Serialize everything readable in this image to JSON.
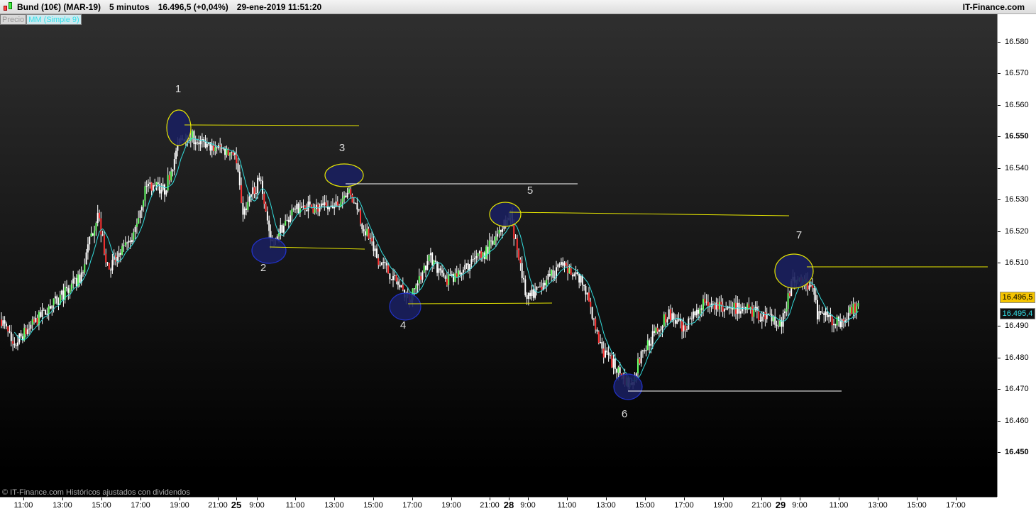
{
  "header": {
    "instrument": "Bund (10€) (MAR-19)",
    "timeframe": "5 minutos",
    "last_price": "16.496,5 (+0,04%)",
    "datetime": "29-ene-2019 11:51:20",
    "brand": "IT-Finance.com"
  },
  "legend": {
    "price": "Precio",
    "indicator": "MM (Simple 9)"
  },
  "footer": {
    "copyright": "© IT-Finance.com  Históricos ajustados con dividendos"
  },
  "colors": {
    "up": "#66ff66",
    "down": "#ff3333",
    "ma": "#33dddd",
    "annotation_fill": "#1a1f5e",
    "yellow": "#e8e800",
    "blue": "#2233cc"
  },
  "y_axis": {
    "labels": [
      "16.580",
      "16.570",
      "16.560",
      "16.550",
      "16.540",
      "16.530",
      "16.520",
      "16.510",
      "16.490",
      "16.480",
      "16.470",
      "16.460",
      "16.450"
    ],
    "bold": [
      "16.550",
      "16.450"
    ],
    "range": [
      16.44,
      16.588
    ]
  },
  "badges": {
    "price": "16.496,5",
    "ma": "16.495,4"
  },
  "x_axis": {
    "labels": [
      "11:00",
      "13:00",
      "15:00",
      "17:00",
      "19:00",
      "21:00",
      "25",
      "9:00",
      "11:00",
      "13:00",
      "15:00",
      "17:00",
      "19:00",
      "21:00",
      "28",
      "9:00",
      "11:00",
      "13:00",
      "15:00",
      "17:00",
      "19:00",
      "21:00",
      "29",
      "9:00",
      "11:00",
      "13:00",
      "15:00",
      "17:00"
    ],
    "day_markers": [
      "25",
      "28",
      "29"
    ]
  },
  "chart_data": {
    "type": "candlestick",
    "indicator": "MM (Simple 9)",
    "price_path": [
      [
        0,
        16.492
      ],
      [
        7,
        16.484
      ],
      [
        26,
        16.494
      ],
      [
        48,
        16.505
      ],
      [
        59,
        16.526
      ],
      [
        65,
        16.508
      ],
      [
        80,
        16.517
      ],
      [
        89,
        16.535
      ],
      [
        100,
        16.533
      ],
      [
        109,
        16.548
      ],
      [
        113,
        16.551
      ],
      [
        126,
        16.547
      ],
      [
        143,
        16.545
      ],
      [
        148,
        16.526
      ],
      [
        159,
        16.537
      ],
      [
        165,
        16.517
      ],
      [
        183,
        16.528
      ],
      [
        204,
        16.527
      ],
      [
        212,
        16.533
      ],
      [
        230,
        16.512
      ],
      [
        250,
        16.498
      ],
      [
        263,
        16.512
      ],
      [
        272,
        16.504
      ],
      [
        296,
        16.513
      ],
      [
        312,
        16.525
      ],
      [
        322,
        16.498
      ],
      [
        343,
        16.509
      ],
      [
        357,
        16.503
      ],
      [
        367,
        16.483
      ],
      [
        385,
        16.471
      ],
      [
        393,
        16.482
      ],
      [
        409,
        16.494
      ],
      [
        417,
        16.489
      ],
      [
        430,
        16.497
      ],
      [
        457,
        16.495
      ],
      [
        478,
        16.491
      ],
      [
        485,
        16.505
      ],
      [
        496,
        16.503
      ],
      [
        500,
        16.494
      ],
      [
        513,
        16.491
      ],
      [
        525,
        16.497
      ]
    ],
    "annotations": [
      {
        "label": "1",
        "level": 16.554
      },
      {
        "label": "2",
        "level": 16.515
      },
      {
        "label": "3",
        "level": 16.535
      },
      {
        "label": "4",
        "level": 16.497
      },
      {
        "label": "5",
        "level": 16.526
      },
      {
        "label": "6",
        "level": 16.469
      },
      {
        "label": "7",
        "level": 16.509
      }
    ]
  }
}
